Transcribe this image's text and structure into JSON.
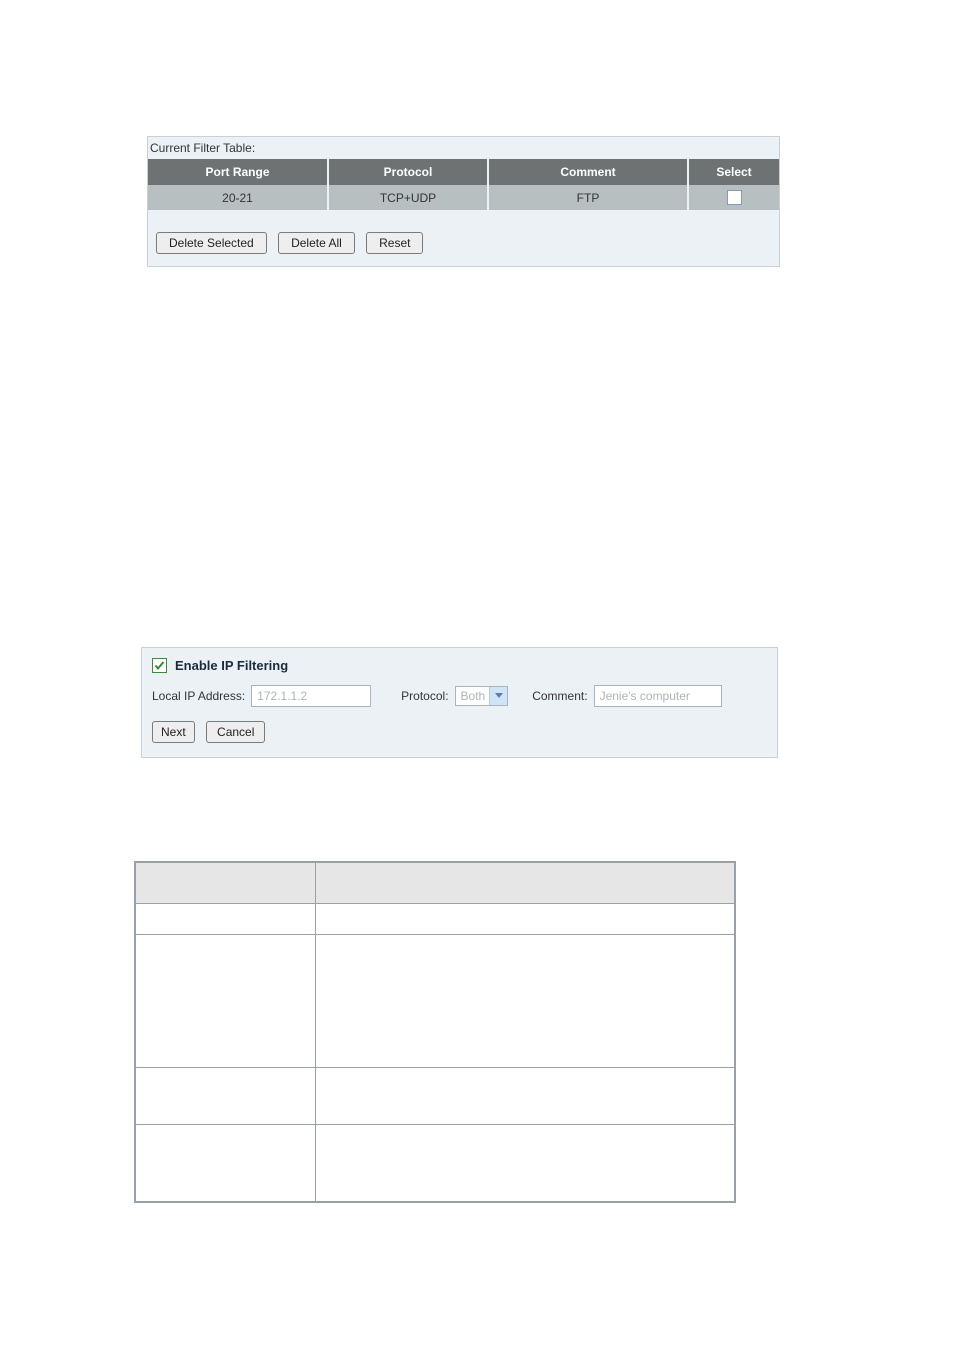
{
  "filter_table": {
    "caption": "Current Filter Table:",
    "headers": {
      "port_range": "Port Range",
      "protocol": "Protocol",
      "comment": "Comment",
      "select": "Select"
    },
    "rows": [
      {
        "port_range": "20-21",
        "protocol": "TCP+UDP",
        "comment": "FTP",
        "selected": false
      }
    ],
    "buttons": {
      "delete_selected": "Delete Selected",
      "delete_all": "Delete All",
      "reset": "Reset"
    }
  },
  "ip_filter_form": {
    "enable_checked": true,
    "enable_label": "Enable IP Filtering",
    "local_ip_label": "Local IP Address:",
    "local_ip_value": "172.1.1.2",
    "protocol_label": "Protocol:",
    "protocol_value": "Both",
    "comment_label": "Comment:",
    "comment_value": "Jenie's computer",
    "buttons": {
      "next": "Next",
      "cancel": "Cancel"
    }
  }
}
